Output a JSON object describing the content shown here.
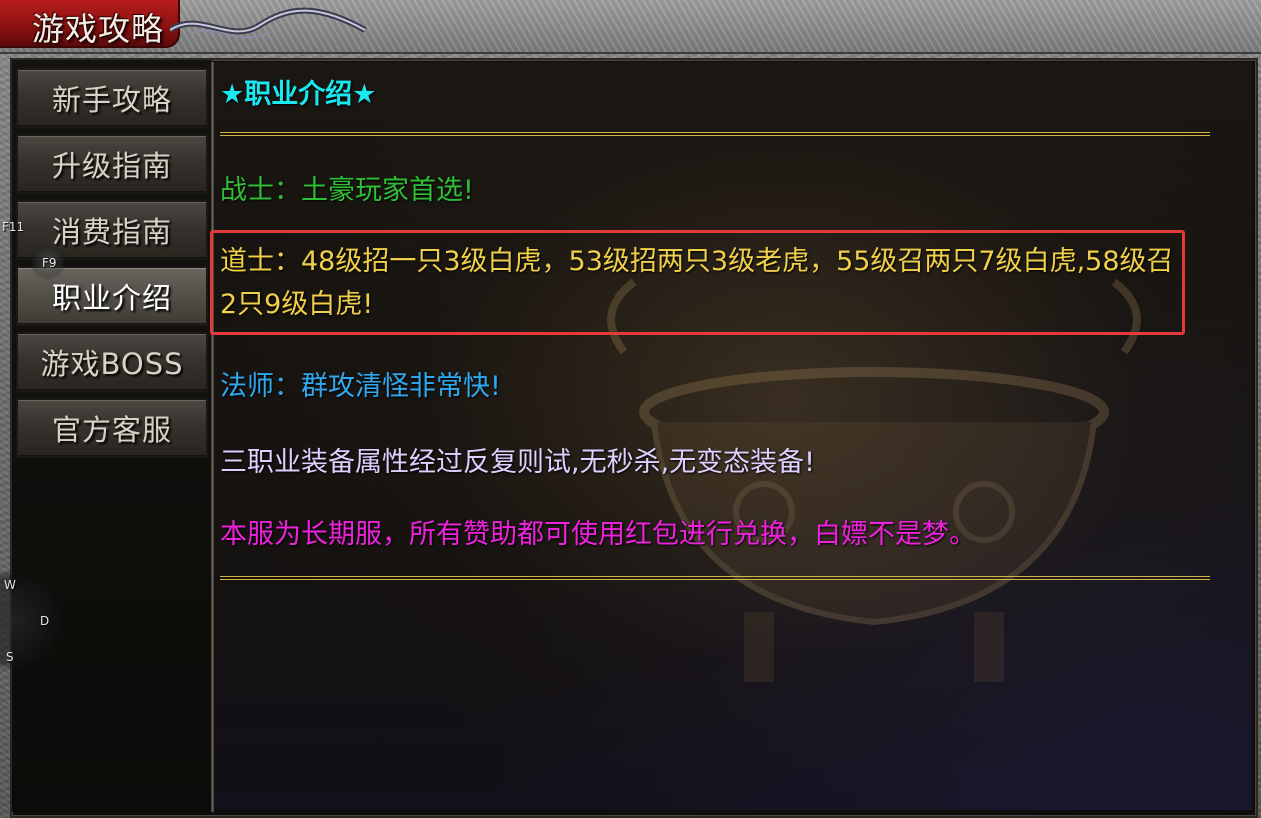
{
  "window": {
    "title": "游戏攻略"
  },
  "sidebar": {
    "tabs": [
      {
        "label": "新手攻略"
      },
      {
        "label": "升级指南"
      },
      {
        "label": "消费指南"
      },
      {
        "label": "职业介绍",
        "active": true
      },
      {
        "label": "游戏BOSS"
      },
      {
        "label": "官方客服"
      }
    ]
  },
  "content": {
    "heading": "★职业介绍★",
    "warrior": "战士：土豪玩家首选!",
    "taoist": "道士：48级招一只3级白虎，53级招两只3级老虎，55级召两只7级白虎,58级召2只9级白虎!",
    "mage": "法师：群攻清怪非常快!",
    "equipment": "三职业装备属性经过反复则试,无秒杀,无变态装备!",
    "server": "本服为长期服，所有赞助都可使用红包进行兑换，白嫖不是梦。"
  },
  "hotkeys": {
    "f11": "F11",
    "f9": "F9",
    "w": "W",
    "d": "D",
    "s": "S"
  },
  "colors": {
    "heading": "#19e8f0",
    "warrior": "#2fbf36",
    "taoist": "#f0d04a",
    "mage": "#2fa8f0",
    "equipment": "#ddd0ff",
    "server": "#ee22dd",
    "highlight": "#e43a3a",
    "rule": "#d0b640"
  }
}
